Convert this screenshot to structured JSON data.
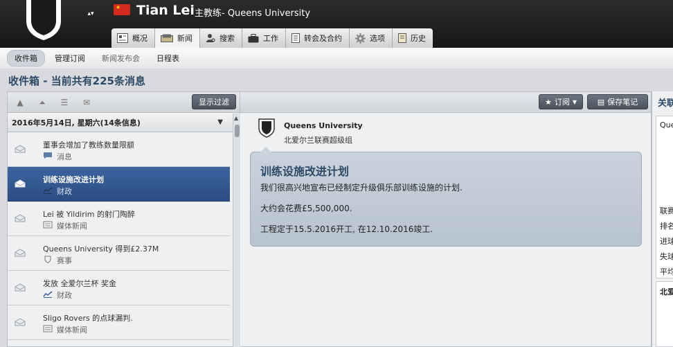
{
  "header": {
    "manager_name": "Tian Lei",
    "manager_role": "主教练- Queens University",
    "flag_symbol": "★",
    "updown_symbols": "▴▾"
  },
  "tabs": [
    {
      "label": "概况",
      "icon": "overview-icon"
    },
    {
      "label": "新闻",
      "icon": "news-icon"
    },
    {
      "label": "搜索",
      "icon": "search-person-icon"
    },
    {
      "label": "工作",
      "icon": "briefcase-icon"
    },
    {
      "label": "转会及合约",
      "icon": "contract-icon"
    },
    {
      "label": "选项",
      "icon": "gear-icon"
    },
    {
      "label": "历史",
      "icon": "history-icon"
    }
  ],
  "subnav": [
    {
      "label": "收件箱",
      "active": true
    },
    {
      "label": "管理订阅",
      "active": false
    },
    {
      "label": "新闻发布会",
      "active": false,
      "dim": true
    },
    {
      "label": "日程表",
      "active": false
    }
  ],
  "page_title": "收件箱 - 当前共有225条消息",
  "left_toolbar": {
    "filter_button": "显示过滤"
  },
  "date_header": "2016年5月14日, 星期六(14条信息)",
  "messages": [
    {
      "subject": "董事会增加了教练数量限额",
      "category": "消息",
      "category_icon": "speech-bubble-icon"
    },
    {
      "subject": "训练设施改进计划",
      "category": "财政",
      "category_icon": "finance-chart-icon"
    },
    {
      "subject": "Lei 被 Yildirim 的射门陶醉",
      "category": "媒体新闻",
      "category_icon": "newspaper-icon"
    },
    {
      "subject": "Queens University 得到£2.37M",
      "category": "赛事",
      "category_icon": "shield-icon"
    },
    {
      "subject": "发放 全爱尔兰杯 奖金",
      "category": "财政",
      "category_icon": "finance-chart-icon"
    },
    {
      "subject": "Sligo Rovers 的点球漏判.",
      "category": "媒体新闻",
      "category_icon": "newspaper-icon"
    }
  ],
  "center_toolbar": {
    "subscribe_button": "订阅",
    "save_note_button": "保存笔记"
  },
  "message_detail": {
    "sender": "Queens University",
    "league": "北爱尔兰联赛超级组",
    "title": "训练设施改进计划",
    "lines": [
      "我们很高兴地宣布已经制定升级俱乐部训练设施的计划.",
      "大约会花费£5,500,000.",
      "工程定于15.5.2016开工, 在12.10.2016竣工."
    ]
  },
  "right_panel": {
    "header": "关联",
    "club_short": "Quee",
    "stats": [
      "联赛",
      "排名",
      "进球",
      "失球",
      "平均"
    ],
    "section2": "北爱"
  },
  "colors": {
    "selected_row": "#2f5289",
    "title_blue": "#2c4a66",
    "flag_red": "#d52b1e"
  }
}
